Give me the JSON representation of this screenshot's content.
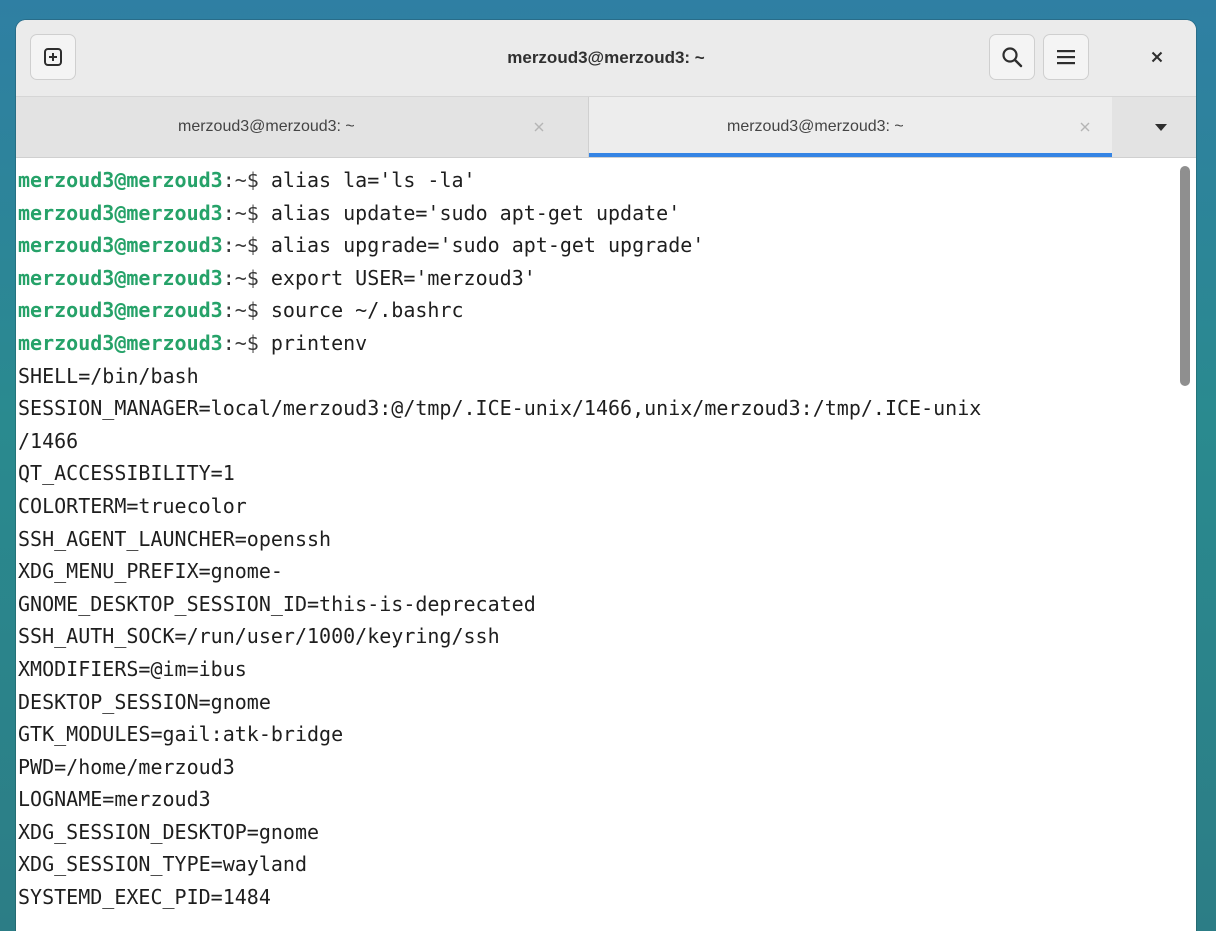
{
  "window": {
    "title": "merzoud3@merzoud3: ~"
  },
  "tabs": [
    {
      "label": "merzoud3@merzoud3: ~",
      "active": false
    },
    {
      "label": "merzoud3@merzoud3: ~",
      "active": true
    }
  ],
  "icons": {
    "new_tab": "plus-square-icon",
    "search": "search-icon",
    "menu": "hamburger-menu-icon",
    "close": "close-icon",
    "tab_close": "close-icon",
    "tab_list": "chevron-down-icon"
  },
  "colors": {
    "prompt_user": "#26a269",
    "active_tab_indicator": "#3584e4"
  },
  "terminal": {
    "prompts": [
      {
        "user": "merzoud3@merzoud3",
        "path": ":~$",
        "command": " alias la='ls -la'"
      },
      {
        "user": "merzoud3@merzoud3",
        "path": ":~$",
        "command": " alias update='sudo apt-get update'"
      },
      {
        "user": "merzoud3@merzoud3",
        "path": ":~$",
        "command": " alias upgrade='sudo apt-get upgrade'"
      },
      {
        "user": "merzoud3@merzoud3",
        "path": ":~$",
        "command": " export USER='merzoud3'"
      },
      {
        "user": "merzoud3@merzoud3",
        "path": ":~$",
        "command": " source ~/.bashrc"
      },
      {
        "user": "merzoud3@merzoud3",
        "path": ":~$",
        "command": " printenv"
      }
    ],
    "output": [
      "SHELL=/bin/bash",
      "SESSION_MANAGER=local/merzoud3:@/tmp/.ICE-unix/1466,unix/merzoud3:/tmp/.ICE-unix",
      "/1466",
      "QT_ACCESSIBILITY=1",
      "COLORTERM=truecolor",
      "SSH_AGENT_LAUNCHER=openssh",
      "XDG_MENU_PREFIX=gnome-",
      "GNOME_DESKTOP_SESSION_ID=this-is-deprecated",
      "SSH_AUTH_SOCK=/run/user/1000/keyring/ssh",
      "XMODIFIERS=@im=ibus",
      "DESKTOP_SESSION=gnome",
      "GTK_MODULES=gail:atk-bridge",
      "PWD=/home/merzoud3",
      "LOGNAME=merzoud3",
      "XDG_SESSION_DESKTOP=gnome",
      "XDG_SESSION_TYPE=wayland",
      "SYSTEMD_EXEC_PID=1484"
    ]
  }
}
